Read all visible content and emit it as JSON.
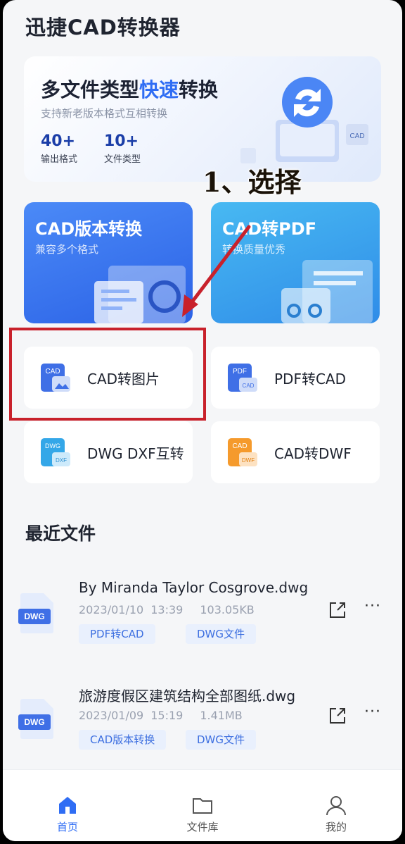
{
  "app": {
    "title": "迅捷CAD转换器"
  },
  "banner": {
    "title_prefix": "多文件类型",
    "title_highlight": "快速",
    "title_suffix": "转换",
    "subtitle": "支持新老版本格式互相转换",
    "stats": [
      {
        "num": "40+",
        "label": "输出格式"
      },
      {
        "num": "10+",
        "label": "文件类型"
      }
    ],
    "art_badge": "CAD"
  },
  "annotation": {
    "text": "1、选择",
    "color": "#c8212b"
  },
  "big_cards": [
    {
      "title": "CAD版本转换",
      "subtitle": "兼容多个格式"
    },
    {
      "title": "CAD转PDF",
      "subtitle": "转换质量优秀"
    }
  ],
  "tools": [
    {
      "label": "CAD转图片",
      "icon": "cad-to-image-icon",
      "badge": "CAD"
    },
    {
      "label": "PDF转CAD",
      "icon": "pdf-to-cad-icon",
      "badge": "PDF",
      "badge2": "CAD"
    },
    {
      "label": "DWG DXF互转",
      "icon": "dwg-dxf-icon",
      "badge": "DWG",
      "badge2": "DXF"
    },
    {
      "label": "CAD转DWF",
      "icon": "cad-to-dwf-icon",
      "badge": "CAD",
      "badge2": "DWF"
    }
  ],
  "recent": {
    "heading": "最近文件",
    "files": [
      {
        "name": "By Miranda Taylor Cosgrove.dwg",
        "date": "2023/01/10",
        "time": "13:39",
        "size": "103.05KB",
        "tags": [
          "PDF转CAD",
          "DWG文件"
        ],
        "type": "DWG"
      },
      {
        "name": "旅游度假区建筑结构全部图纸.dwg",
        "date": "2023/01/09",
        "time": "15:19",
        "size": "1.41MB",
        "tags": [
          "CAD版本转换",
          "DWG文件"
        ],
        "type": "DWG"
      }
    ],
    "more": "···"
  },
  "nav": [
    {
      "label": "首页",
      "icon": "home-icon",
      "active": true
    },
    {
      "label": "文件库",
      "icon": "folder-icon",
      "active": false
    },
    {
      "label": "我的",
      "icon": "user-icon",
      "active": false
    }
  ],
  "colors": {
    "accent": "#2f6df4",
    "annotation_red": "#c8212b",
    "tag_bg": "#e9f0fd"
  }
}
